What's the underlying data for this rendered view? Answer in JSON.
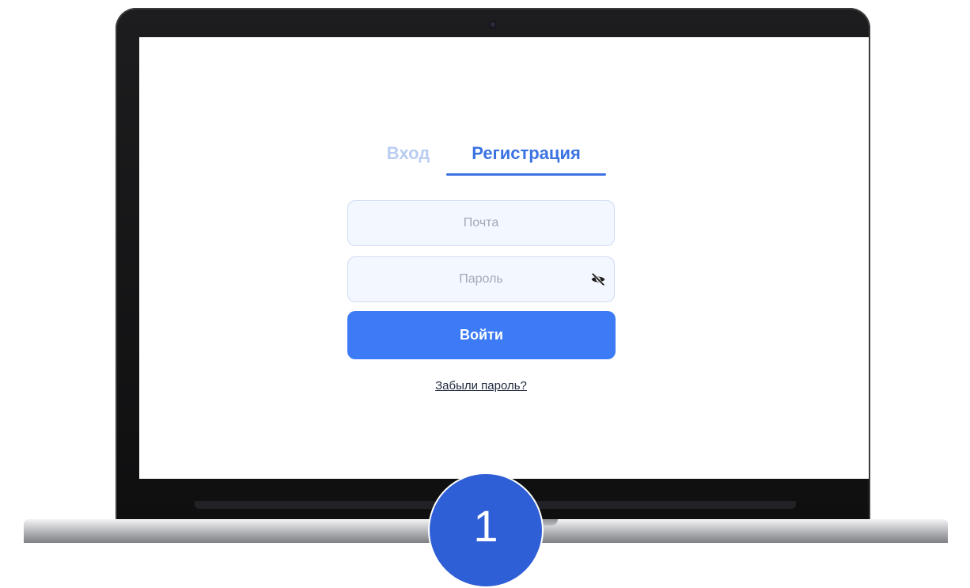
{
  "auth": {
    "tabs": {
      "login": "Вход",
      "register": "Регистрация",
      "active": "register"
    },
    "email": {
      "placeholder": "Почта",
      "value": ""
    },
    "password": {
      "placeholder": "Пароль",
      "value": "",
      "toggle_icon": "eye-off-icon"
    },
    "submit_label": "Войти",
    "forgot_link": "Забыли пароль?"
  },
  "step_badge": {
    "number": "1"
  },
  "colors": {
    "accent": "#3d7bf6",
    "tab_active": "#3b73e2",
    "tab_inactive": "#b9cdf2",
    "input_bg": "#f3f7ff",
    "badge": "#2f5fd6"
  }
}
